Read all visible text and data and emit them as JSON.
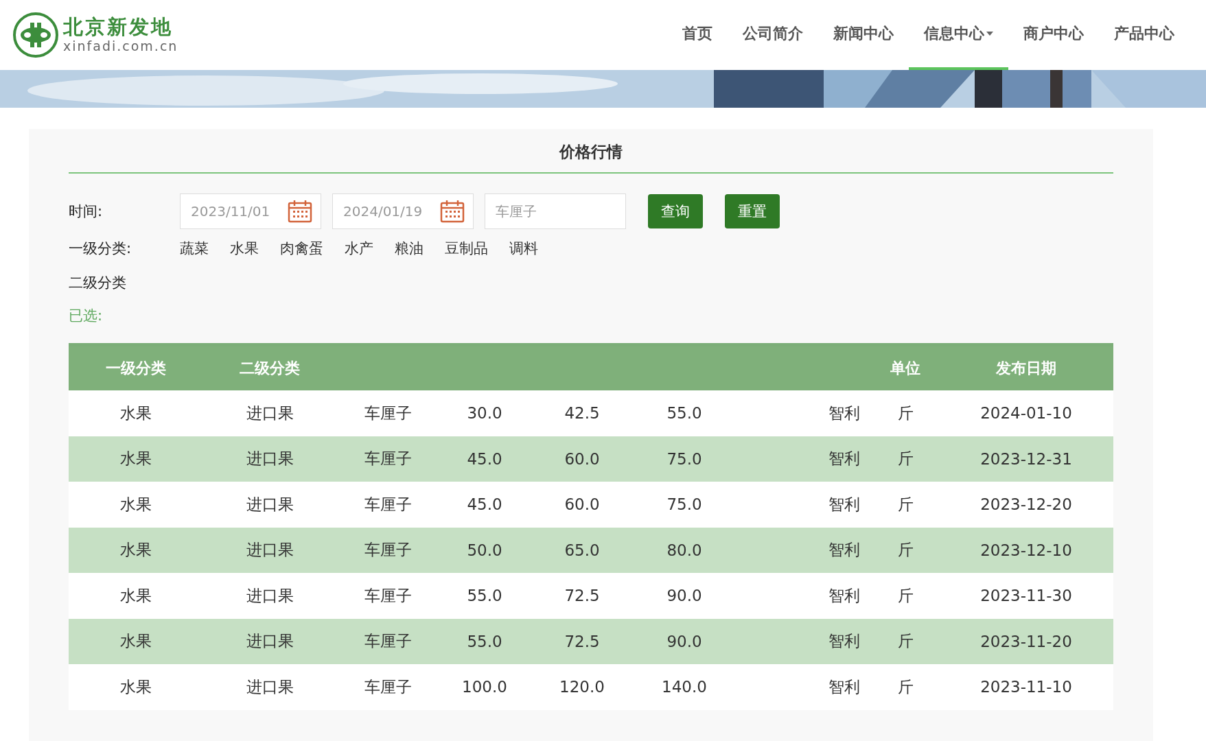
{
  "logo": {
    "name": "北京新发地",
    "domain": "xinfadi.com.cn"
  },
  "nav": [
    {
      "label": "首页",
      "selected": false,
      "has_menu": false
    },
    {
      "label": "公司简介",
      "selected": false,
      "has_menu": false
    },
    {
      "label": "新闻中心",
      "selected": false,
      "has_menu": false
    },
    {
      "label": "信息中心",
      "selected": true,
      "has_menu": true
    },
    {
      "label": "商户中心",
      "selected": false,
      "has_menu": false
    },
    {
      "label": "产品中心",
      "selected": false,
      "has_menu": false
    }
  ],
  "panel": {
    "title": "价格行情",
    "time_label": "时间:",
    "date_from": "2023/11/01",
    "date_to": "2024/01/19",
    "keyword": {
      "placeholder": "车厘子"
    },
    "buttons": [
      "查询",
      "重置"
    ],
    "category_label": "一级分类:",
    "categories": [
      "蔬菜",
      "水果",
      "肉禽蛋",
      "水产",
      "粮油",
      "豆制品",
      "调料"
    ],
    "subcategory_label": "二级分类",
    "selected_label": "已选:"
  },
  "table": {
    "columns": [
      {
        "label": "一级分类"
      },
      {
        "label": "二级分类"
      },
      {},
      {},
      {},
      {},
      {},
      {},
      {
        "label": "单位"
      },
      {
        "label": "发布日期"
      }
    ],
    "rows": [
      [
        "水果",
        "进口果",
        "车厘子",
        "30.0",
        "42.5",
        "55.0",
        "",
        "智利",
        "斤",
        "2024-01-10"
      ],
      [
        "水果",
        "进口果",
        "车厘子",
        "45.0",
        "60.0",
        "75.0",
        "",
        "智利",
        "斤",
        "2023-12-31"
      ],
      [
        "水果",
        "进口果",
        "车厘子",
        "45.0",
        "60.0",
        "75.0",
        "",
        "智利",
        "斤",
        "2023-12-20"
      ],
      [
        "水果",
        "进口果",
        "车厘子",
        "50.0",
        "65.0",
        "80.0",
        "",
        "智利",
        "斤",
        "2023-12-10"
      ],
      [
        "水果",
        "进口果",
        "车厘子",
        "55.0",
        "72.5",
        "90.0",
        "",
        "智利",
        "斤",
        "2023-11-30"
      ],
      [
        "水果",
        "进口果",
        "车厘子",
        "55.0",
        "72.5",
        "90.0",
        "",
        "智利",
        "斤",
        "2023-11-20"
      ],
      [
        "水果",
        "进口果",
        "车厘子",
        "100.0",
        "120.0",
        "140.0",
        "",
        "智利",
        "斤",
        "2023-11-10"
      ]
    ]
  }
}
